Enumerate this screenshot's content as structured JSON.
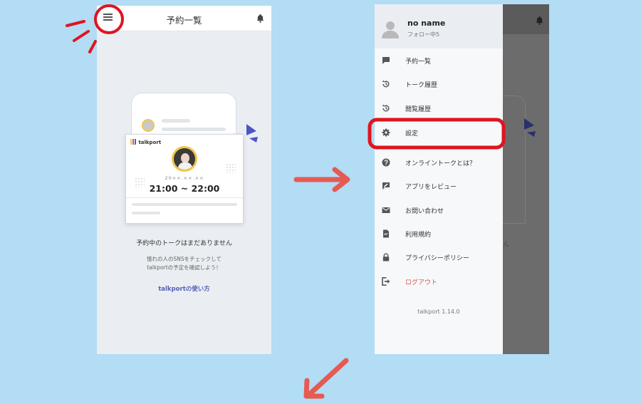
{
  "colors": {
    "background": "#b3dcf5",
    "highlight_red": "#e0141e",
    "arrow_red": "#e55a52",
    "link_blue": "#5361b5",
    "logout_red": "#e0554f"
  },
  "left_screen": {
    "title": "予約一覧",
    "menu_icon": "hamburger-menu-icon",
    "bell_icon": "bell-icon",
    "illustration": {
      "logo_text": "talkport",
      "date": "20××.××.××",
      "time": "21:00 ~ 22:00"
    },
    "empty_message": "予約中のトークはまだありません",
    "sub_message_line1": "憧れの人のSNSをチェックして",
    "sub_message_line2": "talkportの予定を確認しよう！",
    "howto_link": "talkportの使い方"
  },
  "right_screen": {
    "user": {
      "name": "no name",
      "following": "フォロー中5",
      "avatar_icon": "user-avatar-icon"
    },
    "menu": [
      {
        "label": "予約一覧",
        "icon": "chat-bubble-icon"
      },
      {
        "label": "トーク履歴",
        "icon": "history-icon"
      },
      {
        "label": "閲覧履歴",
        "icon": "history-icon"
      },
      {
        "label": "設定",
        "icon": "gear-icon"
      },
      {
        "label": "オンライントークとは？",
        "icon": "help-circle-icon"
      },
      {
        "label": "アプリをレビュー",
        "icon": "review-icon"
      },
      {
        "label": "お問い合わせ",
        "icon": "mail-icon"
      },
      {
        "label": "利用規約",
        "icon": "document-icon"
      },
      {
        "label": "プライバシーポリシー",
        "icon": "lock-icon"
      },
      {
        "label": "ログアウト",
        "icon": "logout-icon"
      }
    ],
    "overlay_text": "ん",
    "version": "talkport 1.14.0"
  }
}
